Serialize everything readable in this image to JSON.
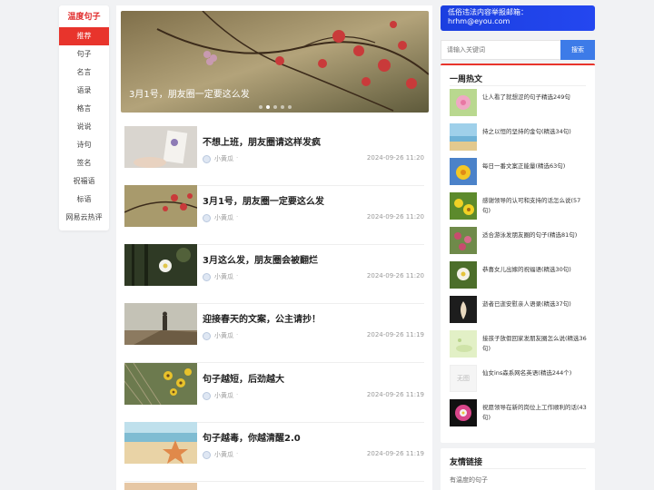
{
  "nav": {
    "brand": "温度句子",
    "items": [
      "推荐",
      "句子",
      "名言",
      "语录",
      "格言",
      "说说",
      "诗句",
      "签名",
      "祝福语",
      "标语",
      "网易云热评"
    ]
  },
  "slider": {
    "caption": "3月1号，朋友圈一定要这么发",
    "dot_count": 5,
    "active_dot": 1
  },
  "posts": [
    {
      "title": "不想上班，朋友圈请这样发疯",
      "author": "小黄瓜",
      "sep": "·",
      "date": "2024-09-26 11:20"
    },
    {
      "title": "3月1号，朋友圈一定要这么发",
      "author": "小黄瓜",
      "sep": "·",
      "date": "2024-09-26 11:20"
    },
    {
      "title": "3月这么发，朋友圈会被翻烂",
      "author": "小黄瓜",
      "sep": "·",
      "date": "2024-09-26 11:20"
    },
    {
      "title": "迎接春天的文案，公主请抄！",
      "author": "小黄瓜",
      "sep": "·",
      "date": "2024-09-26 11:19"
    },
    {
      "title": "句子越短，后劲越大",
      "author": "小黄瓜",
      "sep": "·",
      "date": "2024-09-26 11:19"
    },
    {
      "title": "句子越毒，你越清醒2.0",
      "author": "小黄瓜",
      "sep": "·",
      "date": "2024-09-26 11:19"
    }
  ],
  "notice": {
    "line1": "低俗违法内容举报邮箱：",
    "line2": "hrhm@eyou.com"
  },
  "search": {
    "placeholder": "请输入关键词",
    "button": "搜索"
  },
  "hot": {
    "title": "一周热文",
    "items": [
      "让人看了就想涩的句子精选249句",
      "持之以恒的坚持的金句(精选34句)",
      "每日一番文案正能量(精选63句)",
      "感谢领导的认可和支持的话怎么说(57句)",
      "适合游泳发朋友圈的句子(精选81句)",
      "恭喜女儿出嫁的祝福语(精选30句)",
      "逝者已逝安慰亲人语录(精选37句)",
      "接孩子放假回家发朋友圈怎么说(精选36句)",
      "仙女ins森系网名英语(精选244个)",
      "祝愿领导在新的岗位上工作顺利的话(43句)"
    ],
    "noimg": "无图"
  },
  "links": {
    "title": "友情链接",
    "item": "有温度的句子"
  }
}
